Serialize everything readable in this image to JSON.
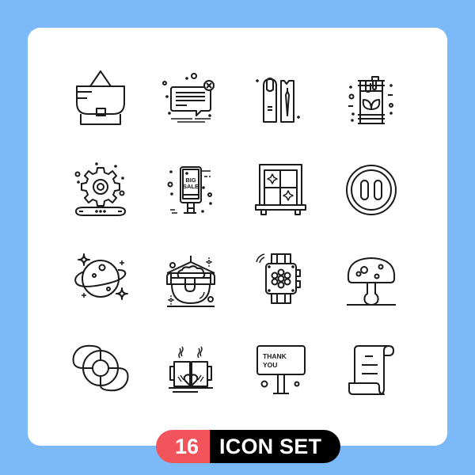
{
  "colors": {
    "background": "#7cb9f8",
    "card": "#ffffff",
    "icon_stroke": "#1a1a1a",
    "badge_number_bg": "#f2545b",
    "badge_text_bg": "#000000",
    "badge_text": "#ffffff"
  },
  "icons": [
    {
      "name": "bag-icon",
      "row": 1,
      "col": 1
    },
    {
      "name": "chat-delete-icon",
      "row": 1,
      "col": 2
    },
    {
      "name": "nail-polish-icon",
      "row": 1,
      "col": 3
    },
    {
      "name": "eco-barrel-icon",
      "row": 1,
      "col": 4
    },
    {
      "name": "gear-wrench-icon",
      "row": 2,
      "col": 1
    },
    {
      "name": "big-sale-board-icon",
      "row": 2,
      "col": 2,
      "text_line1": "BIG",
      "text_line2": "SALE"
    },
    {
      "name": "window-icon",
      "row": 2,
      "col": 3
    },
    {
      "name": "pause-button-icon",
      "row": 2,
      "col": 4
    },
    {
      "name": "planet-icon",
      "row": 3,
      "col": 1
    },
    {
      "name": "cauldron-icon",
      "row": 3,
      "col": 2
    },
    {
      "name": "smartwatch-icon",
      "row": 3,
      "col": 3
    },
    {
      "name": "mushroom-icon",
      "row": 3,
      "col": 4
    },
    {
      "name": "lifebuoy-icon",
      "row": 4,
      "col": 1
    },
    {
      "name": "coffee-cups-love-icon",
      "row": 4,
      "col": 2
    },
    {
      "name": "thank-you-board-icon",
      "row": 4,
      "col": 3,
      "text_line1": "THANK",
      "text_line2": "YOU"
    },
    {
      "name": "scroll-document-icon",
      "row": 4,
      "col": 4
    }
  ],
  "badge": {
    "count": "16",
    "label": "ICON SET"
  }
}
